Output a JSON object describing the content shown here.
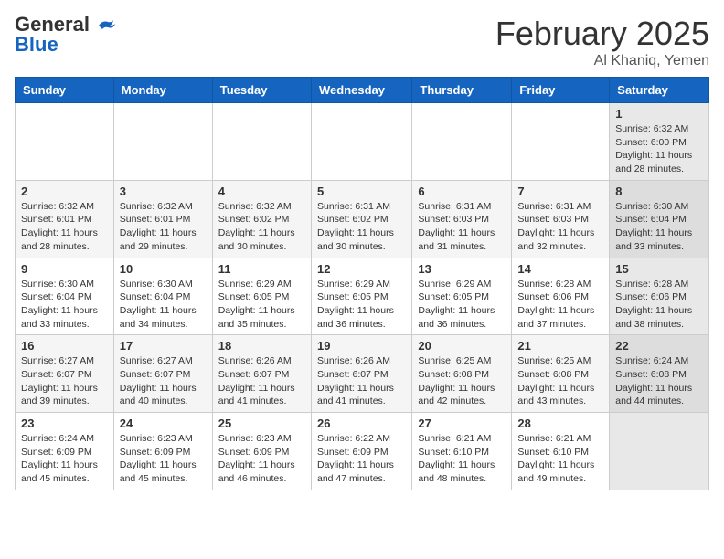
{
  "logo": {
    "general": "General",
    "blue": "Blue"
  },
  "header": {
    "month": "February 2025",
    "location": "Al Khaniq, Yemen"
  },
  "days_of_week": [
    "Sunday",
    "Monday",
    "Tuesday",
    "Wednesday",
    "Thursday",
    "Friday",
    "Saturday"
  ],
  "weeks": [
    [
      {
        "day": "",
        "info": ""
      },
      {
        "day": "",
        "info": ""
      },
      {
        "day": "",
        "info": ""
      },
      {
        "day": "",
        "info": ""
      },
      {
        "day": "",
        "info": ""
      },
      {
        "day": "",
        "info": ""
      },
      {
        "day": "1",
        "info": "Sunrise: 6:32 AM\nSunset: 6:00 PM\nDaylight: 11 hours and 28 minutes."
      }
    ],
    [
      {
        "day": "2",
        "info": "Sunrise: 6:32 AM\nSunset: 6:01 PM\nDaylight: 11 hours and 28 minutes."
      },
      {
        "day": "3",
        "info": "Sunrise: 6:32 AM\nSunset: 6:01 PM\nDaylight: 11 hours and 29 minutes."
      },
      {
        "day": "4",
        "info": "Sunrise: 6:32 AM\nSunset: 6:02 PM\nDaylight: 11 hours and 30 minutes."
      },
      {
        "day": "5",
        "info": "Sunrise: 6:31 AM\nSunset: 6:02 PM\nDaylight: 11 hours and 30 minutes."
      },
      {
        "day": "6",
        "info": "Sunrise: 6:31 AM\nSunset: 6:03 PM\nDaylight: 11 hours and 31 minutes."
      },
      {
        "day": "7",
        "info": "Sunrise: 6:31 AM\nSunset: 6:03 PM\nDaylight: 11 hours and 32 minutes."
      },
      {
        "day": "8",
        "info": "Sunrise: 6:30 AM\nSunset: 6:04 PM\nDaylight: 11 hours and 33 minutes."
      }
    ],
    [
      {
        "day": "9",
        "info": "Sunrise: 6:30 AM\nSunset: 6:04 PM\nDaylight: 11 hours and 33 minutes."
      },
      {
        "day": "10",
        "info": "Sunrise: 6:30 AM\nSunset: 6:04 PM\nDaylight: 11 hours and 34 minutes."
      },
      {
        "day": "11",
        "info": "Sunrise: 6:29 AM\nSunset: 6:05 PM\nDaylight: 11 hours and 35 minutes."
      },
      {
        "day": "12",
        "info": "Sunrise: 6:29 AM\nSunset: 6:05 PM\nDaylight: 11 hours and 36 minutes."
      },
      {
        "day": "13",
        "info": "Sunrise: 6:29 AM\nSunset: 6:05 PM\nDaylight: 11 hours and 36 minutes."
      },
      {
        "day": "14",
        "info": "Sunrise: 6:28 AM\nSunset: 6:06 PM\nDaylight: 11 hours and 37 minutes."
      },
      {
        "day": "15",
        "info": "Sunrise: 6:28 AM\nSunset: 6:06 PM\nDaylight: 11 hours and 38 minutes."
      }
    ],
    [
      {
        "day": "16",
        "info": "Sunrise: 6:27 AM\nSunset: 6:07 PM\nDaylight: 11 hours and 39 minutes."
      },
      {
        "day": "17",
        "info": "Sunrise: 6:27 AM\nSunset: 6:07 PM\nDaylight: 11 hours and 40 minutes."
      },
      {
        "day": "18",
        "info": "Sunrise: 6:26 AM\nSunset: 6:07 PM\nDaylight: 11 hours and 41 minutes."
      },
      {
        "day": "19",
        "info": "Sunrise: 6:26 AM\nSunset: 6:07 PM\nDaylight: 11 hours and 41 minutes."
      },
      {
        "day": "20",
        "info": "Sunrise: 6:25 AM\nSunset: 6:08 PM\nDaylight: 11 hours and 42 minutes."
      },
      {
        "day": "21",
        "info": "Sunrise: 6:25 AM\nSunset: 6:08 PM\nDaylight: 11 hours and 43 minutes."
      },
      {
        "day": "22",
        "info": "Sunrise: 6:24 AM\nSunset: 6:08 PM\nDaylight: 11 hours and 44 minutes."
      }
    ],
    [
      {
        "day": "23",
        "info": "Sunrise: 6:24 AM\nSunset: 6:09 PM\nDaylight: 11 hours and 45 minutes."
      },
      {
        "day": "24",
        "info": "Sunrise: 6:23 AM\nSunset: 6:09 PM\nDaylight: 11 hours and 45 minutes."
      },
      {
        "day": "25",
        "info": "Sunrise: 6:23 AM\nSunset: 6:09 PM\nDaylight: 11 hours and 46 minutes."
      },
      {
        "day": "26",
        "info": "Sunrise: 6:22 AM\nSunset: 6:09 PM\nDaylight: 11 hours and 47 minutes."
      },
      {
        "day": "27",
        "info": "Sunrise: 6:21 AM\nSunset: 6:10 PM\nDaylight: 11 hours and 48 minutes."
      },
      {
        "day": "28",
        "info": "Sunrise: 6:21 AM\nSunset: 6:10 PM\nDaylight: 11 hours and 49 minutes."
      },
      {
        "day": "",
        "info": ""
      }
    ]
  ]
}
